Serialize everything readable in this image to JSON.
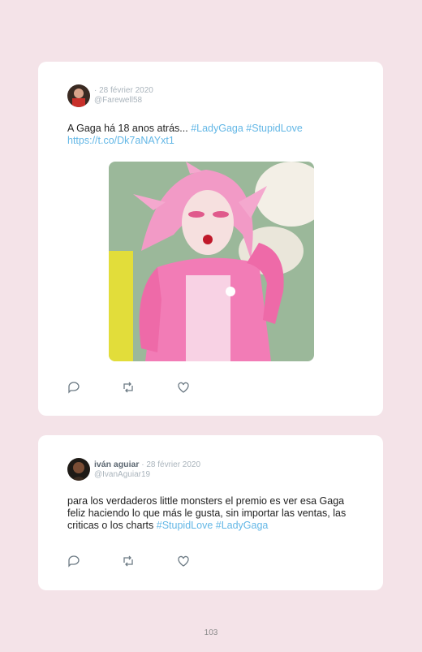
{
  "tweets": [
    {
      "author_name": "",
      "date": "· 28 février 2020",
      "handle": "@Farewell58",
      "text": "A Gaga há 18 anos atrás... ",
      "hashtags": "#LadyGaga #StupidLove",
      "link": "https://t.co/Dk7aNAYxt1"
    },
    {
      "author_name": "iván aguiar",
      "date": " · 28 février 2020",
      "handle": "@IvanAguiar19",
      "text": "para los verdaderos little monsters el premio es ver esa Gaga feliz haciendo lo que más le gusta, sin importar las ventas, las criticas o los charts ",
      "hashtags": "#StupidLove #LadyGaga"
    }
  ],
  "page_number": "103",
  "colors": {
    "background": "#f4e3e8",
    "link": "#63b7e6",
    "meta": "#aab4bc"
  }
}
